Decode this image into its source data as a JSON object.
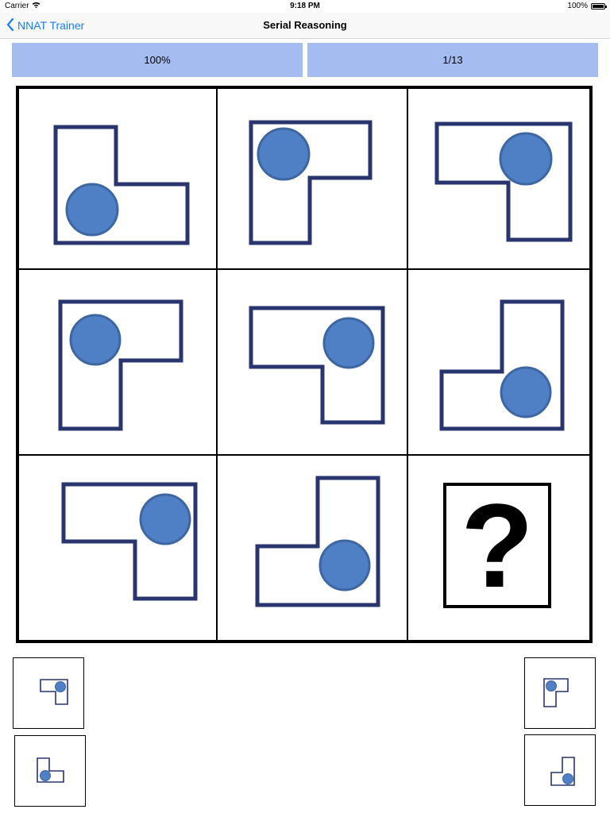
{
  "status_bar": {
    "carrier": "Carrier",
    "time": "9:18 PM",
    "battery": "100%"
  },
  "nav": {
    "back_label": "NNAT Trainer",
    "title": "Serial Reasoning"
  },
  "stats": {
    "score": "100%",
    "progress": "1/13"
  },
  "puzzle": {
    "missing_symbol": "?"
  }
}
